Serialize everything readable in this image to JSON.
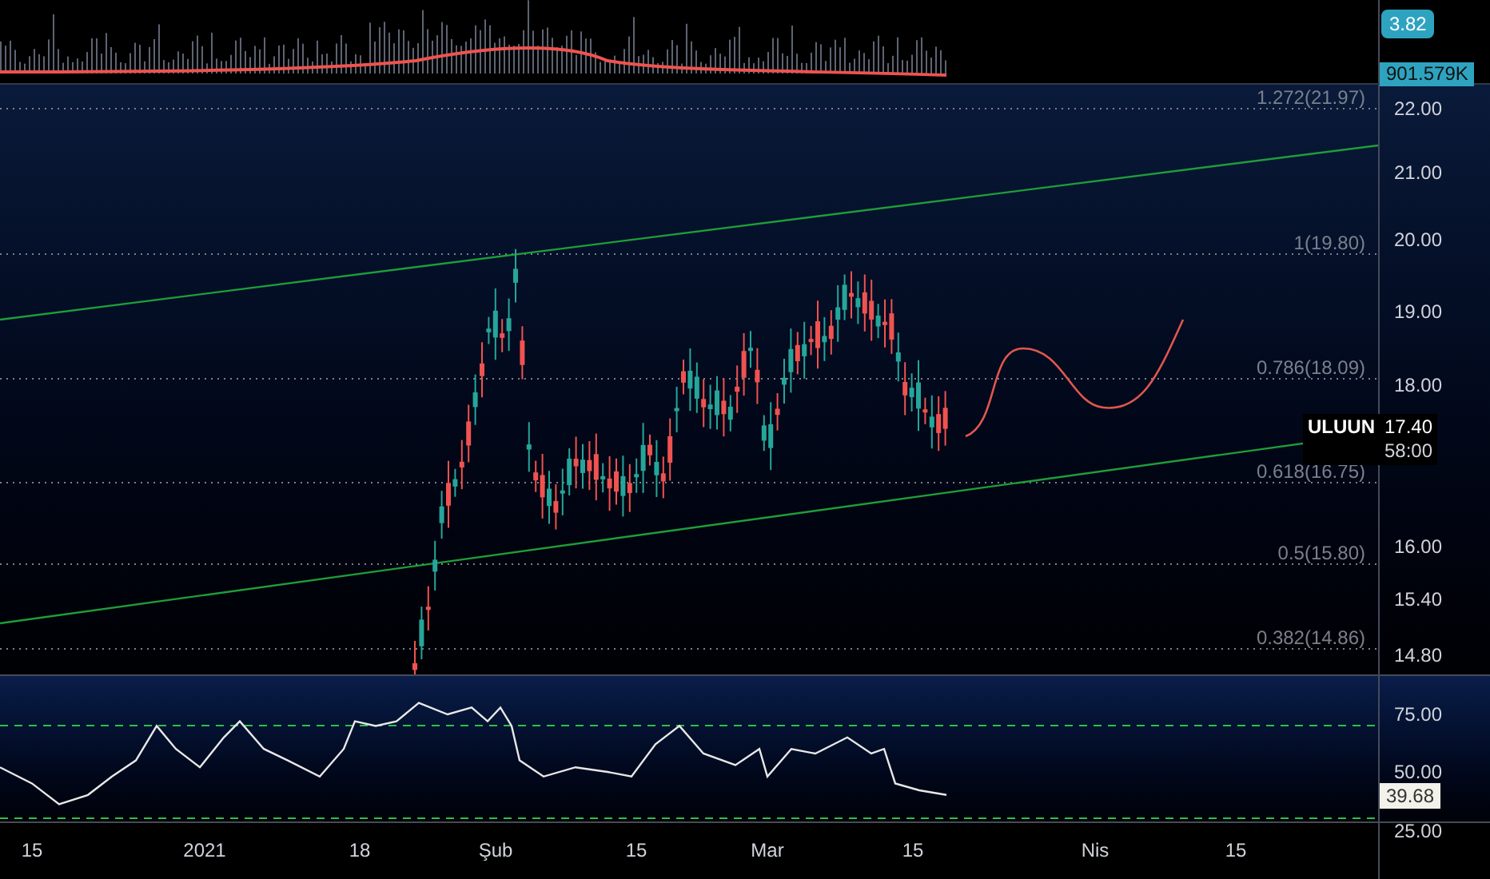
{
  "volume_panel": {
    "value_label": "3.82",
    "volume_label": "901.579K"
  },
  "price_panel": {
    "fib_levels": [
      {
        "label": "1.272(21.97)"
      },
      {
        "label": "1(19.80)"
      },
      {
        "label": "0.786(18.09)"
      },
      {
        "label": "0.618(16.75)"
      },
      {
        "label": "0.5(15.80)"
      },
      {
        "label": "0.382(14.86)"
      }
    ],
    "price_ticks": [
      "22.00",
      "21.00",
      "20.00",
      "19.00",
      "18.00",
      "16.00",
      "15.40",
      "14.80"
    ],
    "last_price": {
      "symbol": "ULUUN",
      "price": "17.40",
      "countdown": "58:00"
    }
  },
  "rsi_panel": {
    "ticks": [
      "75.00",
      "50.00",
      "25.00"
    ],
    "current": "39.68"
  },
  "time_axis": [
    "15",
    "2021",
    "18",
    "Şub",
    "15",
    "Mar",
    "15",
    "Nis",
    "15"
  ]
}
